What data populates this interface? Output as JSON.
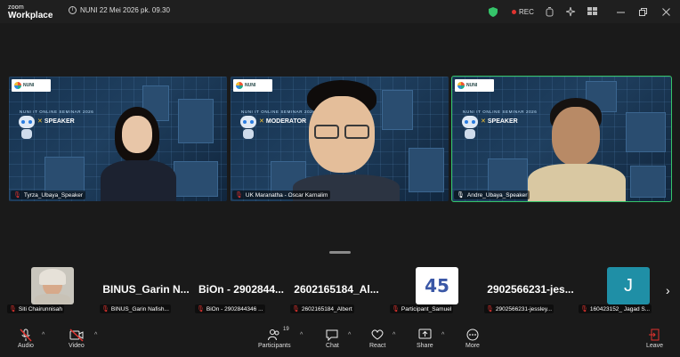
{
  "app": {
    "logo_line1": "zoom",
    "logo_line2": "Workplace",
    "meeting_info": "NUNI 22 Mei 2026 pk. 09.30",
    "rec_label": "REC"
  },
  "video_tiles": [
    {
      "name": "Tyrza_Ubaya_Speaker",
      "role": "SPEAKER",
      "brand": "NUNI",
      "seminar": "NUNI IT ONLINE SEMINAR 2026",
      "active": false
    },
    {
      "name": "UK Maranatha - Oscar Karnalim",
      "role": "MODERATOR",
      "brand": "NUNI",
      "seminar": "NUNI IT ONLINE SEMINAR 2026",
      "active": false
    },
    {
      "name": "Andre_Ubaya_Speaker",
      "role": "SPEAKER",
      "brand": "NUNI",
      "seminar": "NUNI IT ONLINE SEMINAR 2026",
      "active": true
    }
  ],
  "filmstrip": [
    {
      "name": "Siti Chairunnisah",
      "display": "",
      "kind": "photo"
    },
    {
      "name": "BINUS_Garin Nafish...",
      "display": "BINUS_Garin N...",
      "kind": "text"
    },
    {
      "name": "BiOn - 2902844346 ...",
      "display": "BiOn - 2902844...",
      "kind": "text"
    },
    {
      "name": "2602165184_Albert",
      "display": "2602165184_Al...",
      "kind": "text"
    },
    {
      "name": "Participant_Samuel",
      "display": "45",
      "kind": "logo"
    },
    {
      "name": "2902566231-jessley...",
      "display": "2902566231-jes...",
      "kind": "text"
    },
    {
      "name": "160423152_ Jagad S...",
      "display": "J",
      "kind": "avatar"
    }
  ],
  "toolbar": {
    "audio": "Audio",
    "video": "Video",
    "participants": "Participants",
    "participants_count": "19",
    "chat": "Chat",
    "react": "React",
    "share": "Share",
    "more": "More",
    "leave": "Leave"
  },
  "colors": {
    "accent_green": "#35c46a",
    "rec_red": "#e0332f",
    "avatar_teal": "#1f8fa6"
  }
}
